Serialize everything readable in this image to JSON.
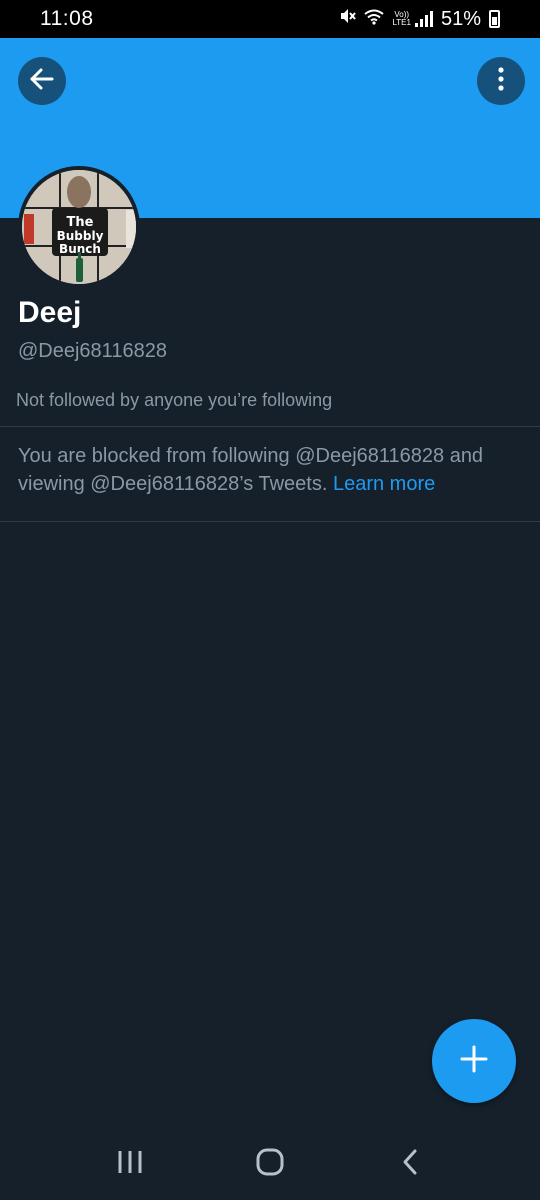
{
  "status_bar": {
    "time": "11:08",
    "battery_percent": "51%",
    "network_label": "LTE1",
    "volte_label": "Vo))"
  },
  "header": {
    "banner_color": "#1d9bf0",
    "back_icon": "arrow-left-icon",
    "more_icon": "more-vertical-icon"
  },
  "profile": {
    "avatar_text": [
      "The",
      "Bubbly",
      "Bunch"
    ],
    "display_name": "Deej",
    "handle": "@Deej68116828",
    "followed_by": "Not followed by anyone you’re following"
  },
  "blocked": {
    "message": "You are blocked from following @Deej68116828 and viewing @Deej68116828’s Tweets.",
    "learn_more": "Learn more"
  },
  "fab": {
    "icon": "plus-icon",
    "color": "#1d9bf0"
  },
  "nav": {
    "recents_icon": "recents-icon",
    "home_icon": "home-circle-icon",
    "back_icon": "chevron-left-icon"
  }
}
